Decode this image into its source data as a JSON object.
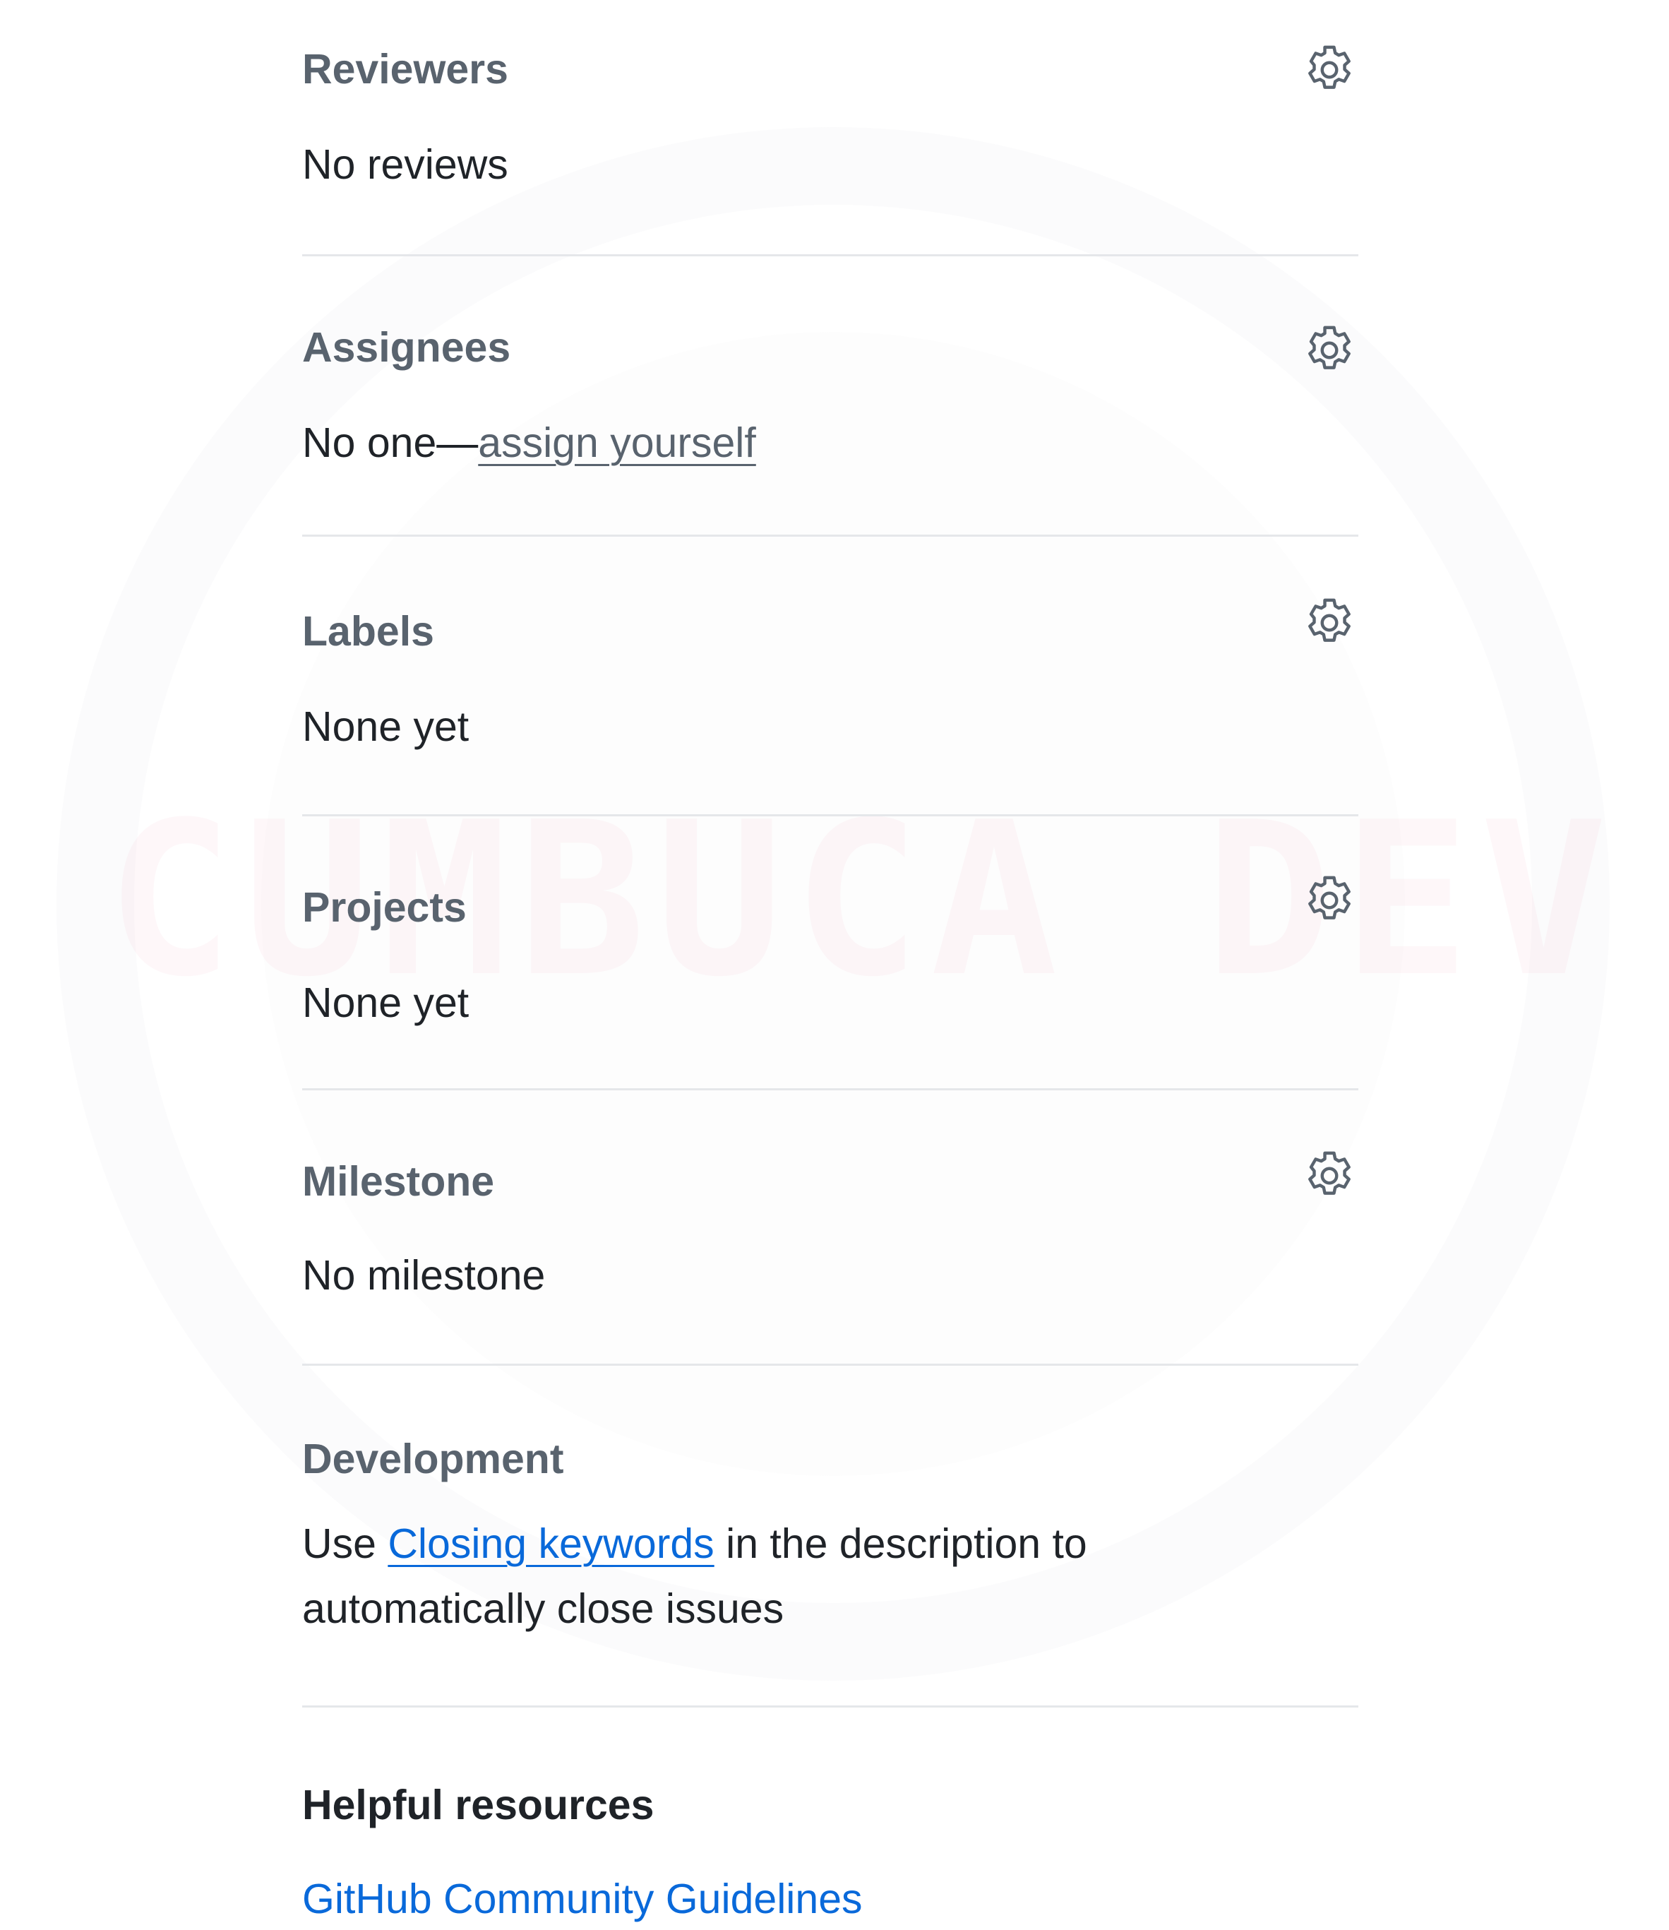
{
  "sidebar": {
    "reviewers": {
      "heading": "Reviewers",
      "value": "No reviews",
      "icon": "gear-icon"
    },
    "assignees": {
      "heading": "Assignees",
      "value_prefix": "No one—",
      "link": "assign yourself",
      "icon": "gear-icon"
    },
    "labels": {
      "heading": "Labels",
      "value": "None yet",
      "icon": "gear-icon"
    },
    "projects": {
      "heading": "Projects",
      "value": "None yet",
      "icon": "gear-icon"
    },
    "milestone": {
      "heading": "Milestone",
      "value": "No milestone",
      "icon": "gear-icon"
    },
    "development": {
      "heading": "Development",
      "text_before": "Use ",
      "link": "Closing keywords",
      "text_after": " in the description to automatically close issues"
    },
    "resources": {
      "heading": "Helpful resources",
      "link": "GitHub Community Guidelines"
    }
  },
  "watermark": {
    "text": "CUMBUCA DEV"
  },
  "colors": {
    "link": "#0969da",
    "muted": "#59636e",
    "text": "#1f2328",
    "divider": "#e5e7ea"
  }
}
